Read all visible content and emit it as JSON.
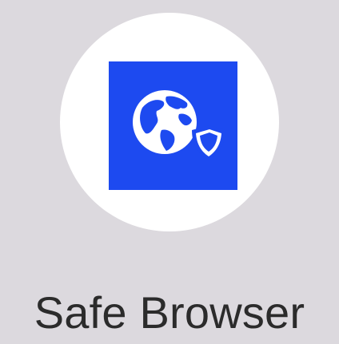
{
  "app": {
    "label": "Safe Browser",
    "icon": "globe-shield-icon"
  },
  "colors": {
    "background": "#dcd9de",
    "icon_circle": "#ffffff",
    "icon_tile": "#1d4af0",
    "glyph": "#ffffff",
    "label_text": "#2b2b2b"
  }
}
